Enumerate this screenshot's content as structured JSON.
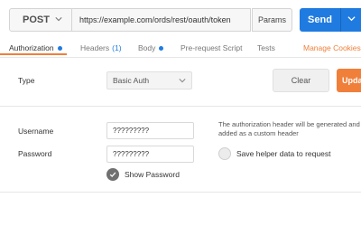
{
  "request": {
    "method": "POST",
    "url": "https://example.com/ords/rest/oauth/token",
    "params_label": "Params",
    "send_label": "Send"
  },
  "tabs": [
    {
      "label": "Authorization",
      "active": true
    },
    {
      "label": "Headers",
      "count": "(1)"
    },
    {
      "label": "Body"
    },
    {
      "label": "Pre-request Script"
    },
    {
      "label": "Tests"
    }
  ],
  "manage_cookies": "Manage Cookies",
  "auth": {
    "type_label": "Type",
    "type_value": "Basic Auth",
    "clear_label": "Clear",
    "update_label": "Update",
    "username_label": "Username",
    "username_value": "?????????",
    "password_label": "Password",
    "password_value": "?????????",
    "show_password_label": "Show Password",
    "note": "The authorization header will be generated and added as a custom header",
    "save_helper_label": "Save helper data to request"
  },
  "colors": {
    "accent_blue": "#1f7be0",
    "accent_orange": "#f07f3a"
  }
}
